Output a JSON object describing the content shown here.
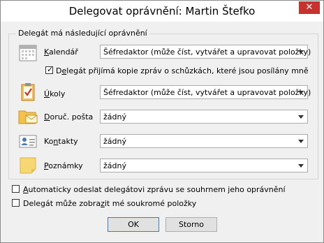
{
  "window": {
    "title": "Delegovat oprávnění: Martin Štefko",
    "close_glyph": "✕"
  },
  "group": {
    "legend": "Delegát má následující oprávnění"
  },
  "rows": [
    {
      "label_before": "",
      "label_accel": "K",
      "label_after": "alendář",
      "value": "Šéfredaktor (může číst, vytvářet a upravovat položky)",
      "icon": "calendar-icon"
    },
    {
      "label_before": "",
      "label_accel": "Ú",
      "label_after": "koly",
      "value": "Šéfredaktor (může číst, vytvářet a upravovat položky)",
      "icon": "tasks-clipboard-icon"
    },
    {
      "label_before": "",
      "label_accel": "D",
      "label_after": "oruč. pošta",
      "value": "žádný",
      "icon": "inbox-folder-icon"
    },
    {
      "label_before": "Ko",
      "label_accel": "n",
      "label_after": "takty",
      "value": "žádný",
      "icon": "contact-card-icon"
    },
    {
      "label_before": "",
      "label_accel": "P",
      "label_after": "oznámky",
      "value": "žádný",
      "icon": "note-icon"
    }
  ],
  "meeting_copy": {
    "before": "D",
    "accel": "e",
    "after": "legát přijímá kopie zpráv o schůzkách, které jsou posílány mně",
    "checked": true
  },
  "auto_send": {
    "before": "",
    "accel": "A",
    "after": "utomaticky odeslat delegátovi zprávu se souhrnem jeho oprávnění",
    "checked": false
  },
  "private_items": {
    "before": "Delegát může zobra",
    "accel": "z",
    "after": "it mé soukromé položky",
    "checked": false
  },
  "buttons": {
    "ok": "OK",
    "cancel": "Storno"
  },
  "colors": {
    "close": "#c7312e",
    "accent_border": "#3c7fb1",
    "note_yellow": "#f7d774",
    "folder_yellow": "#f2c14e"
  }
}
